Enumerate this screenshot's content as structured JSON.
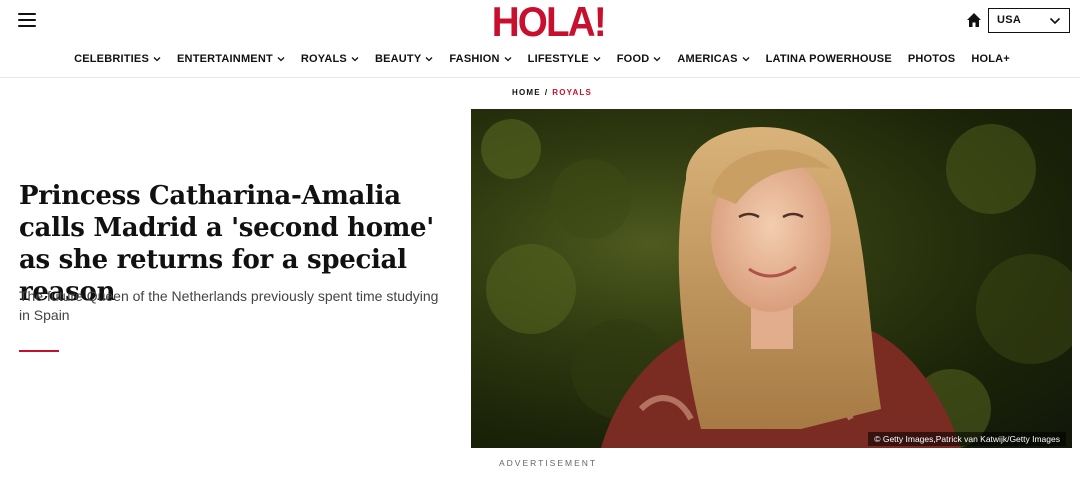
{
  "header": {
    "logo": "HOLA!",
    "country_selector": {
      "value": "USA"
    }
  },
  "nav": {
    "items": [
      {
        "label": "CELEBRITIES",
        "has_dropdown": true
      },
      {
        "label": "ENTERTAINMENT",
        "has_dropdown": true
      },
      {
        "label": "ROYALS",
        "has_dropdown": true
      },
      {
        "label": "BEAUTY",
        "has_dropdown": true
      },
      {
        "label": "FASHION",
        "has_dropdown": true
      },
      {
        "label": "LIFESTYLE",
        "has_dropdown": true
      },
      {
        "label": "FOOD",
        "has_dropdown": true
      },
      {
        "label": "AMERICAS",
        "has_dropdown": true
      },
      {
        "label": "LATINA POWERHOUSE",
        "has_dropdown": false
      },
      {
        "label": "PHOTOS",
        "has_dropdown": false
      },
      {
        "label": "HOLA+",
        "has_dropdown": false
      }
    ]
  },
  "breadcrumb": {
    "home": "HOME",
    "separator": "/",
    "section": "ROYALS"
  },
  "article": {
    "title": "Princess Catharina-Amalia calls Madrid a 'second home' as she returns for a special reason",
    "subtitle": "The future Queen of the Netherlands previously spent time studying in Spain",
    "image_credit": "© Getty Images,Patrick van Katwijk/Getty Images"
  },
  "advertisement_label": "ADVERTISEMENT",
  "colors": {
    "brand": "#c8102e",
    "text": "#111111",
    "muted": "#444444"
  }
}
